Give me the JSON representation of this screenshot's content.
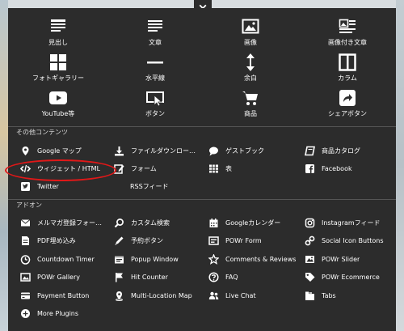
{
  "close_label": "×",
  "grid": [
    {
      "label": "見出し",
      "icon": "heading-icon"
    },
    {
      "label": "文章",
      "icon": "text-icon"
    },
    {
      "label": "画像",
      "icon": "image-icon"
    },
    {
      "label": "画像付き文章",
      "icon": "image-text-icon"
    },
    {
      "label": "フォトギャラリー",
      "icon": "gallery-icon"
    },
    {
      "label": "水平線",
      "icon": "horizontal-line-icon"
    },
    {
      "label": "余白",
      "icon": "spacer-icon"
    },
    {
      "label": "カラム",
      "icon": "columns-icon"
    },
    {
      "label": "YouTube等",
      "icon": "youtube-icon"
    },
    {
      "label": "ボタン",
      "icon": "button-icon"
    },
    {
      "label": "商品",
      "icon": "cart-icon"
    },
    {
      "label": "シェアボタン",
      "icon": "share-icon"
    }
  ],
  "other": {
    "title": "その他コンテンツ",
    "items": [
      {
        "label": "Google マップ",
        "icon": "map-pin-icon"
      },
      {
        "label": "ファイルダウンロー…",
        "icon": "download-icon"
      },
      {
        "label": "ゲストブック",
        "icon": "speech-bubble-icon"
      },
      {
        "label": "商品カタログ",
        "icon": "book-icon"
      },
      {
        "label": "ウィジェット / HTML",
        "icon": "code-icon"
      },
      {
        "label": "フォーム",
        "icon": "edit-icon"
      },
      {
        "label": "表",
        "icon": "table-icon"
      },
      {
        "label": "Facebook",
        "icon": "facebook-icon"
      },
      {
        "label": "Twitter",
        "icon": "twitter-icon"
      },
      {
        "label": "RSSフィード",
        "icon": "rss-icon"
      }
    ]
  },
  "addons": {
    "title": "アドオン",
    "items": [
      {
        "label": "メルマガ登録フォー…",
        "icon": "mail-icon"
      },
      {
        "label": "カスタム検索",
        "icon": "search-icon"
      },
      {
        "label": "Googleカレンダー",
        "icon": "calendar-icon"
      },
      {
        "label": "Instagramフィード",
        "icon": "instagram-icon"
      },
      {
        "label": "PDF埋め込み",
        "icon": "pdf-icon"
      },
      {
        "label": "予約ボタン",
        "icon": "pencil-icon"
      },
      {
        "label": "POWr Form",
        "icon": "form-icon"
      },
      {
        "label": "Social Icon Buttons",
        "icon": "link-icon"
      },
      {
        "label": "Countdown Timer",
        "icon": "timer-icon"
      },
      {
        "label": "Popup Window",
        "icon": "popup-icon"
      },
      {
        "label": "Comments & Reviews",
        "icon": "star-icon"
      },
      {
        "label": "POWr Slider",
        "icon": "slider-icon"
      },
      {
        "label": "POWr Gallery",
        "icon": "photo-icon"
      },
      {
        "label": "Hit Counter",
        "icon": "flag-icon"
      },
      {
        "label": "FAQ",
        "icon": "help-icon"
      },
      {
        "label": "POWr Ecommerce",
        "icon": "tag-icon"
      },
      {
        "label": "Payment Button",
        "icon": "card-icon"
      },
      {
        "label": "Multi-Location Map",
        "icon": "location-icon"
      },
      {
        "label": "Live Chat",
        "icon": "chat-icon"
      },
      {
        "label": "Tabs",
        "icon": "tabs-icon"
      },
      {
        "label": "More Plugins",
        "icon": "plus-icon"
      }
    ]
  }
}
